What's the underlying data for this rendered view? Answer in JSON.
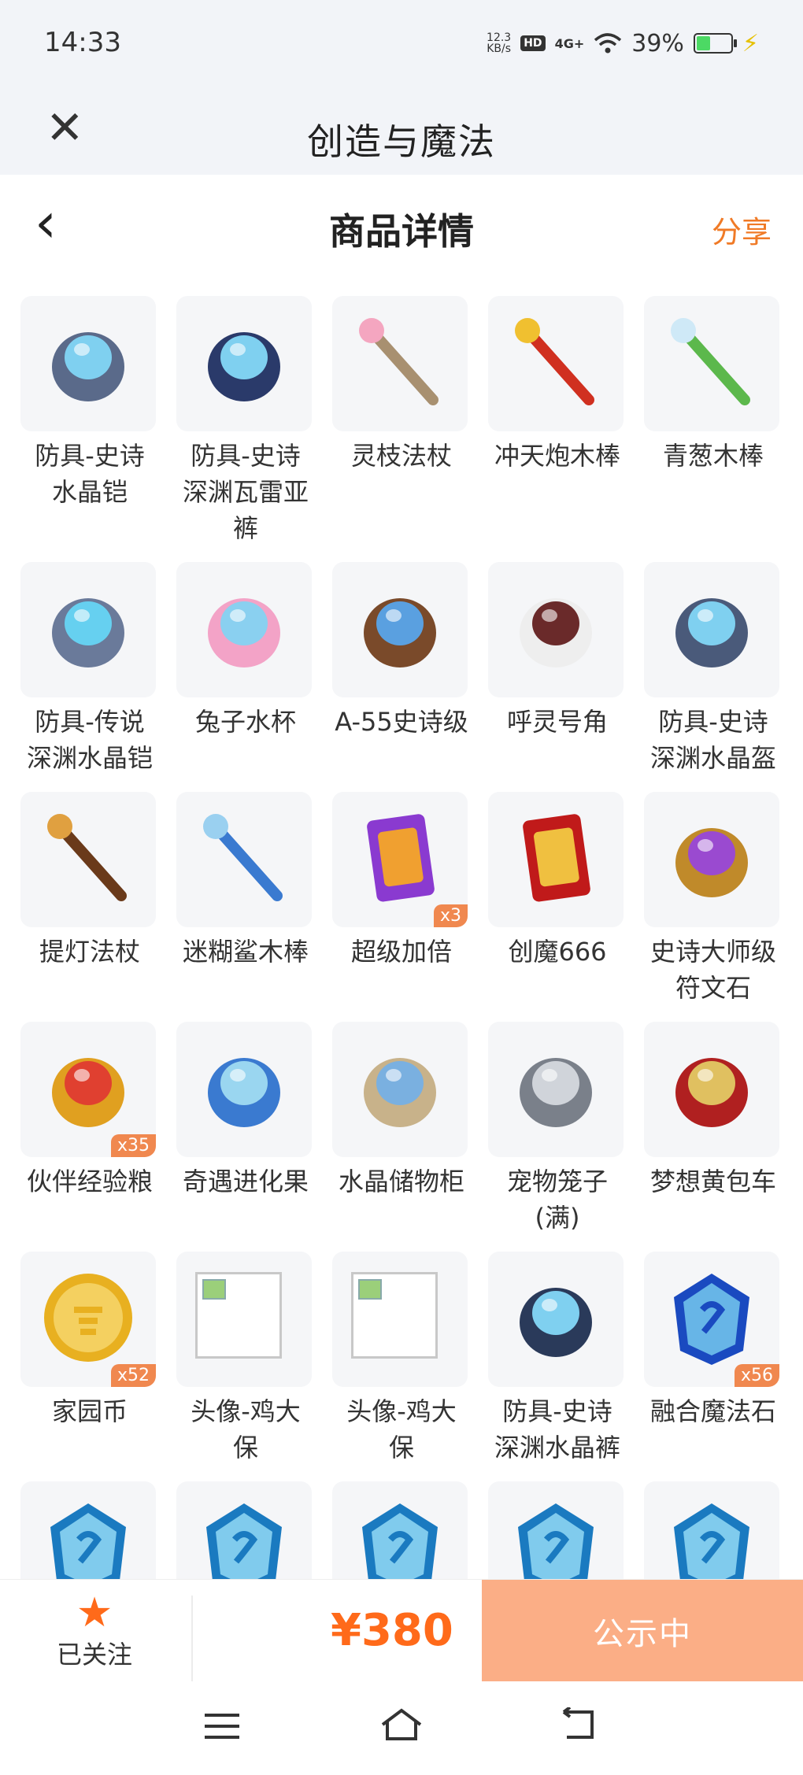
{
  "status": {
    "time": "14:33",
    "net_speed_value": "12.3",
    "net_speed_unit": "KB/s",
    "hd": "HD",
    "signal": "4G+",
    "battery_pct": "39%"
  },
  "appbar": {
    "title": "创造与魔法"
  },
  "header": {
    "title": "商品详情",
    "share": "分享"
  },
  "items": [
    {
      "label": "防具-史诗\n水晶铠",
      "icon": "crystal-armor-icon"
    },
    {
      "label": "防具-史诗\n深渊瓦雷亚\n裤",
      "icon": "abyss-pants-icon"
    },
    {
      "label": "灵枝法杖",
      "icon": "spirit-branch-staff-icon"
    },
    {
      "label": "冲天炮木棒",
      "icon": "firework-rocket-icon"
    },
    {
      "label": "青葱木棒",
      "icon": "green-onion-stick-icon"
    },
    {
      "label": "防具-传说\n深渊水晶铠",
      "icon": "legend-armor-icon"
    },
    {
      "label": "兔子水杯",
      "icon": "bunny-cup-icon"
    },
    {
      "label": "A-55史诗级",
      "icon": "a55-gun-icon"
    },
    {
      "label": "呼灵号角",
      "icon": "horn-icon"
    },
    {
      "label": "防具-史诗\n深渊水晶盔",
      "icon": "crystal-helmet-icon"
    },
    {
      "label": "提灯法杖",
      "icon": "lantern-staff-icon"
    },
    {
      "label": "迷糊鲨木棒",
      "icon": "shark-stick-icon"
    },
    {
      "label": "超级加倍",
      "icon": "super-double-card-icon",
      "qty": "x3"
    },
    {
      "label": "创魔666",
      "icon": "card-666-icon"
    },
    {
      "label": "史诗大师级\n符文石",
      "icon": "rune-stone-icon"
    },
    {
      "label": "伙伴经验粮",
      "icon": "exp-food-bag-icon",
      "qty": "x35"
    },
    {
      "label": "奇遇进化果",
      "icon": "evolution-fruit-icon"
    },
    {
      "label": "水晶储物柜",
      "icon": "crystal-cabinet-icon"
    },
    {
      "label": "宠物笼子\n(满)",
      "icon": "pet-cage-icon"
    },
    {
      "label": "梦想黄包车",
      "icon": "rickshaw-icon"
    },
    {
      "label": "家园币",
      "icon": "home-coin-icon",
      "qty": "x52"
    },
    {
      "label": "头像-鸡大\n保",
      "icon": "broken-image-icon"
    },
    {
      "label": "头像-鸡大\n保",
      "icon": "broken-image-icon"
    },
    {
      "label": "防具-史诗\n深渊水晶裤",
      "icon": "crystal-pants-icon"
    },
    {
      "label": "融合魔法石",
      "icon": "fusion-magic-stone-icon",
      "qty": "x56"
    },
    {
      "label": "",
      "icon": "blue-rune-stone-icon"
    },
    {
      "label": "",
      "icon": "blue-rune-stone-icon"
    },
    {
      "label": "",
      "icon": "blue-rune-stone-icon"
    },
    {
      "label": "",
      "icon": "blue-rune-stone-icon"
    },
    {
      "label": "",
      "icon": "blue-rune-stone-icon"
    }
  ],
  "bottom": {
    "follow_label": "已关注",
    "price": "¥380",
    "status_button": "公示中"
  },
  "colors": {
    "accent": "#f07a26",
    "price": "#ff6a1a",
    "button": "#fbae86"
  }
}
